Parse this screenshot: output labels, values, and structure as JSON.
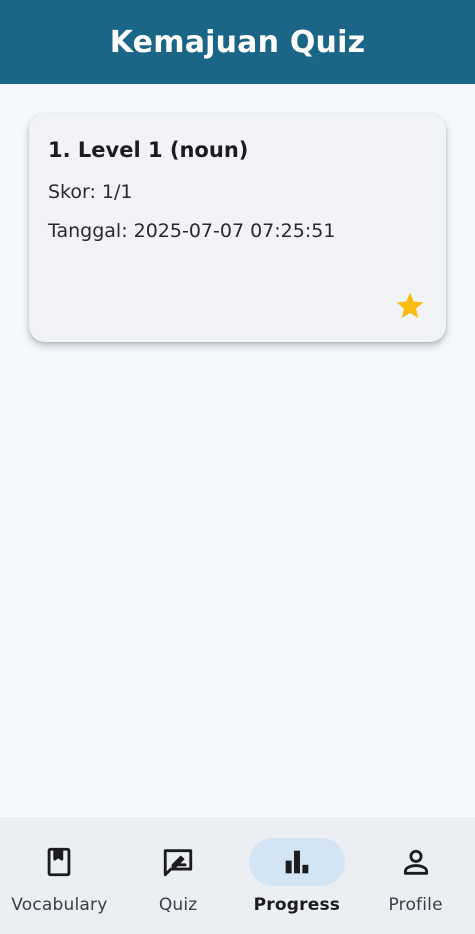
{
  "app_bar": {
    "title": "Kemajuan Quiz"
  },
  "progress_list": [
    {
      "title": "1. Level 1 (noun)",
      "score": "Skor: 1/1",
      "date": "Tanggal: 2025-07-07 07:25:51",
      "icon": "star-icon",
      "icon_color": "#f8bd0f"
    }
  ],
  "bottom_nav": {
    "items": [
      {
        "label": "Vocabulary",
        "icon": "book-icon",
        "active": false
      },
      {
        "label": "Quiz",
        "icon": "quiz-icon",
        "active": false
      },
      {
        "label": "Progress",
        "icon": "bar-chart-icon",
        "active": true
      },
      {
        "label": "Profile",
        "icon": "person-icon",
        "active": false
      }
    ]
  },
  "colors": {
    "app_bar": "#1b6686",
    "background": "#f5f9fe",
    "card": "#f1f3f6",
    "nav_background": "#ebeef2",
    "nav_active_pill": "#d3e5f4",
    "star": "#f8bd0f"
  }
}
